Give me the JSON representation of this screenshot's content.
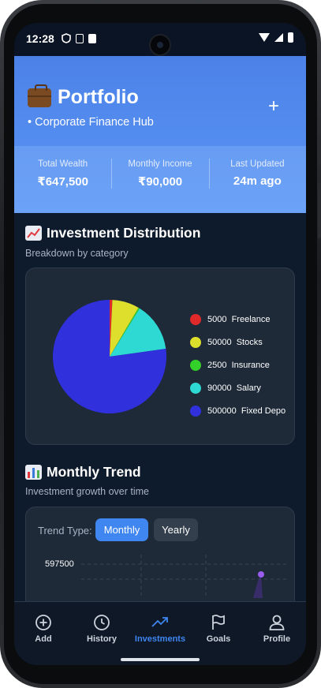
{
  "status_bar": {
    "time": "12:28"
  },
  "header": {
    "title": "Portfolio",
    "subtitle": "• Corporate Finance Hub",
    "plus_label": "+",
    "stats": [
      {
        "label": "Total Wealth",
        "value": "₹647,500"
      },
      {
        "label": "Monthly Income",
        "value": "₹90,000"
      },
      {
        "label": "Last Updated",
        "value": "24m ago"
      }
    ]
  },
  "distribution": {
    "title": "Investment Distribution",
    "subtitle": "Breakdown by category",
    "legend": [
      {
        "value": "5000",
        "name": "Freelance",
        "color": "#e02a2a"
      },
      {
        "value": "50000",
        "name": "Stocks",
        "color": "#dede2c"
      },
      {
        "value": "2500",
        "name": "Insurance",
        "color": "#34d12b"
      },
      {
        "value": "90000",
        "name": "Salary",
        "color": "#2ed9d4"
      },
      {
        "value": "500000",
        "name": "Fixed Depo",
        "color": "#3030dc"
      }
    ]
  },
  "chart_data": {
    "type": "pie",
    "labels": [
      "Freelance",
      "Stocks",
      "Insurance",
      "Salary",
      "Fixed Depo"
    ],
    "values": [
      5000,
      50000,
      2500,
      90000,
      500000
    ],
    "colors": [
      "#e02a2a",
      "#dede2c",
      "#34d12b",
      "#2ed9d4",
      "#3030dc"
    ]
  },
  "trend": {
    "title": "Monthly Trend",
    "subtitle": "Investment growth over time",
    "type_label": "Trend Type:",
    "monthly_label": "Monthly",
    "yearly_label": "Yearly",
    "y_value": "597500",
    "point_color": "#9b5cf0"
  },
  "nav": {
    "add": "Add",
    "history": "History",
    "investments": "Investments",
    "goals": "Goals",
    "profile": "Profile"
  }
}
